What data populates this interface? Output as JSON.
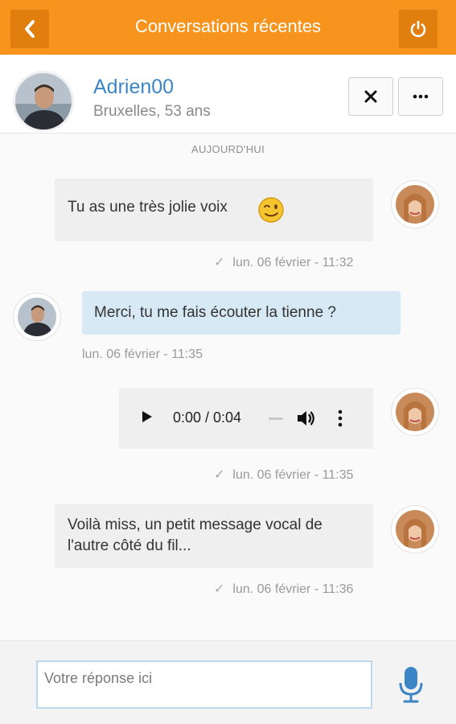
{
  "header": {
    "title": "Conversations récentes"
  },
  "profile": {
    "name": "Adrien00",
    "details": "Bruxelles, 53 ans"
  },
  "chat": {
    "day_label": "AUJOURD'HUI",
    "messages": [
      {
        "direction": "in",
        "text": "Tu as une très jolie voix",
        "emoji": "wink-emoji",
        "time": "lun. 06 février - 11:32"
      },
      {
        "direction": "out",
        "text": "Merci, tu me fais écouter la tienne ?",
        "time": "lun. 06 février - 11:35"
      },
      {
        "direction": "in",
        "type": "audio",
        "audio_time": "0:00 / 0:04",
        "time": "lun. 06 février - 11:35"
      },
      {
        "direction": "in",
        "text": "Voilà miss, un petit message vocal de l'autre côté du fil...",
        "time": "lun. 06 février - 11:36"
      }
    ]
  },
  "composer": {
    "placeholder": "Votre réponse ici"
  },
  "colors": {
    "accent": "#f7941d",
    "accent_dark": "#e07e0e",
    "name_link": "#3d86c6",
    "outgoing_bubble": "#d7e9f5",
    "incoming_bubble": "#efefef",
    "mic": "#3d86c6"
  },
  "icons": [
    "back-chevron-icon",
    "power-icon",
    "close-icon",
    "more-dots-icon",
    "check-icon",
    "play-icon",
    "volume-icon",
    "kebab-icon",
    "microphone-icon"
  ]
}
